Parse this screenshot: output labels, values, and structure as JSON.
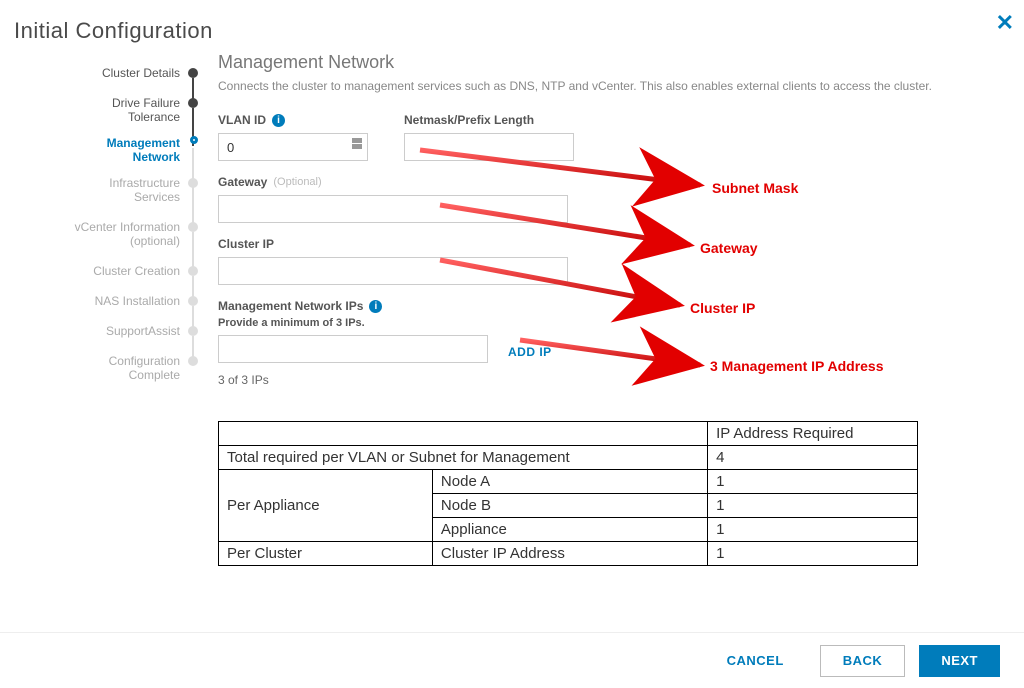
{
  "page_title": "Initial Configuration",
  "close_label": "✕",
  "stepper": [
    {
      "label": "Cluster Details",
      "state": "done"
    },
    {
      "label": "Drive Failure\nTolerance",
      "state": "done"
    },
    {
      "label": "Management\nNetwork",
      "state": "active"
    },
    {
      "label": "Infrastructure\nServices",
      "state": "future"
    },
    {
      "label": "vCenter Information\n(optional)",
      "state": "future"
    },
    {
      "label": "Cluster Creation",
      "state": "future"
    },
    {
      "label": "NAS Installation",
      "state": "future"
    },
    {
      "label": "SupportAssist",
      "state": "future"
    },
    {
      "label": "Configuration\nComplete",
      "state": "future"
    }
  ],
  "section": {
    "title": "Management Network",
    "desc": "Connects the cluster to management services such as DNS, NTP and vCenter. This also enables external clients to access the cluster."
  },
  "fields": {
    "vlan_label": "VLAN ID",
    "vlan_value": "0",
    "netmask_label": "Netmask/Prefix Length",
    "netmask_value": "",
    "gateway_label": "Gateway",
    "gateway_optional": "(Optional)",
    "gateway_value": "",
    "cluster_ip_label": "Cluster IP",
    "cluster_ip_value": "",
    "mgmt_ips_label": "Management Network IPs",
    "mgmt_ips_desc": "Provide a minimum of 3 IPs.",
    "mgmt_ip_value": "",
    "add_ip": "ADD IP",
    "count": "3 of 3 IPs"
  },
  "annotations": {
    "subnet": "Subnet Mask",
    "gateway": "Gateway",
    "cluster_ip": "Cluster IP",
    "mgmt_ip": "3  Management IP Address"
  },
  "table": {
    "header_blank": "",
    "header_req": "IP Address Required",
    "rows": [
      {
        "a": "Total required per VLAN or Subnet for Management",
        "b": "",
        "c": "4",
        "span": 2
      },
      {
        "a": "Per Appliance",
        "b": "Node A",
        "c": "1",
        "rowspan": 3
      },
      {
        "a": "",
        "b": "Node B",
        "c": "1"
      },
      {
        "a": "",
        "b": "Appliance",
        "c": "1"
      },
      {
        "a": "Per Cluster",
        "b": "Cluster IP Address",
        "c": "1"
      }
    ]
  },
  "buttons": {
    "cancel": "CANCEL",
    "back": "BACK",
    "next": "NEXT"
  }
}
